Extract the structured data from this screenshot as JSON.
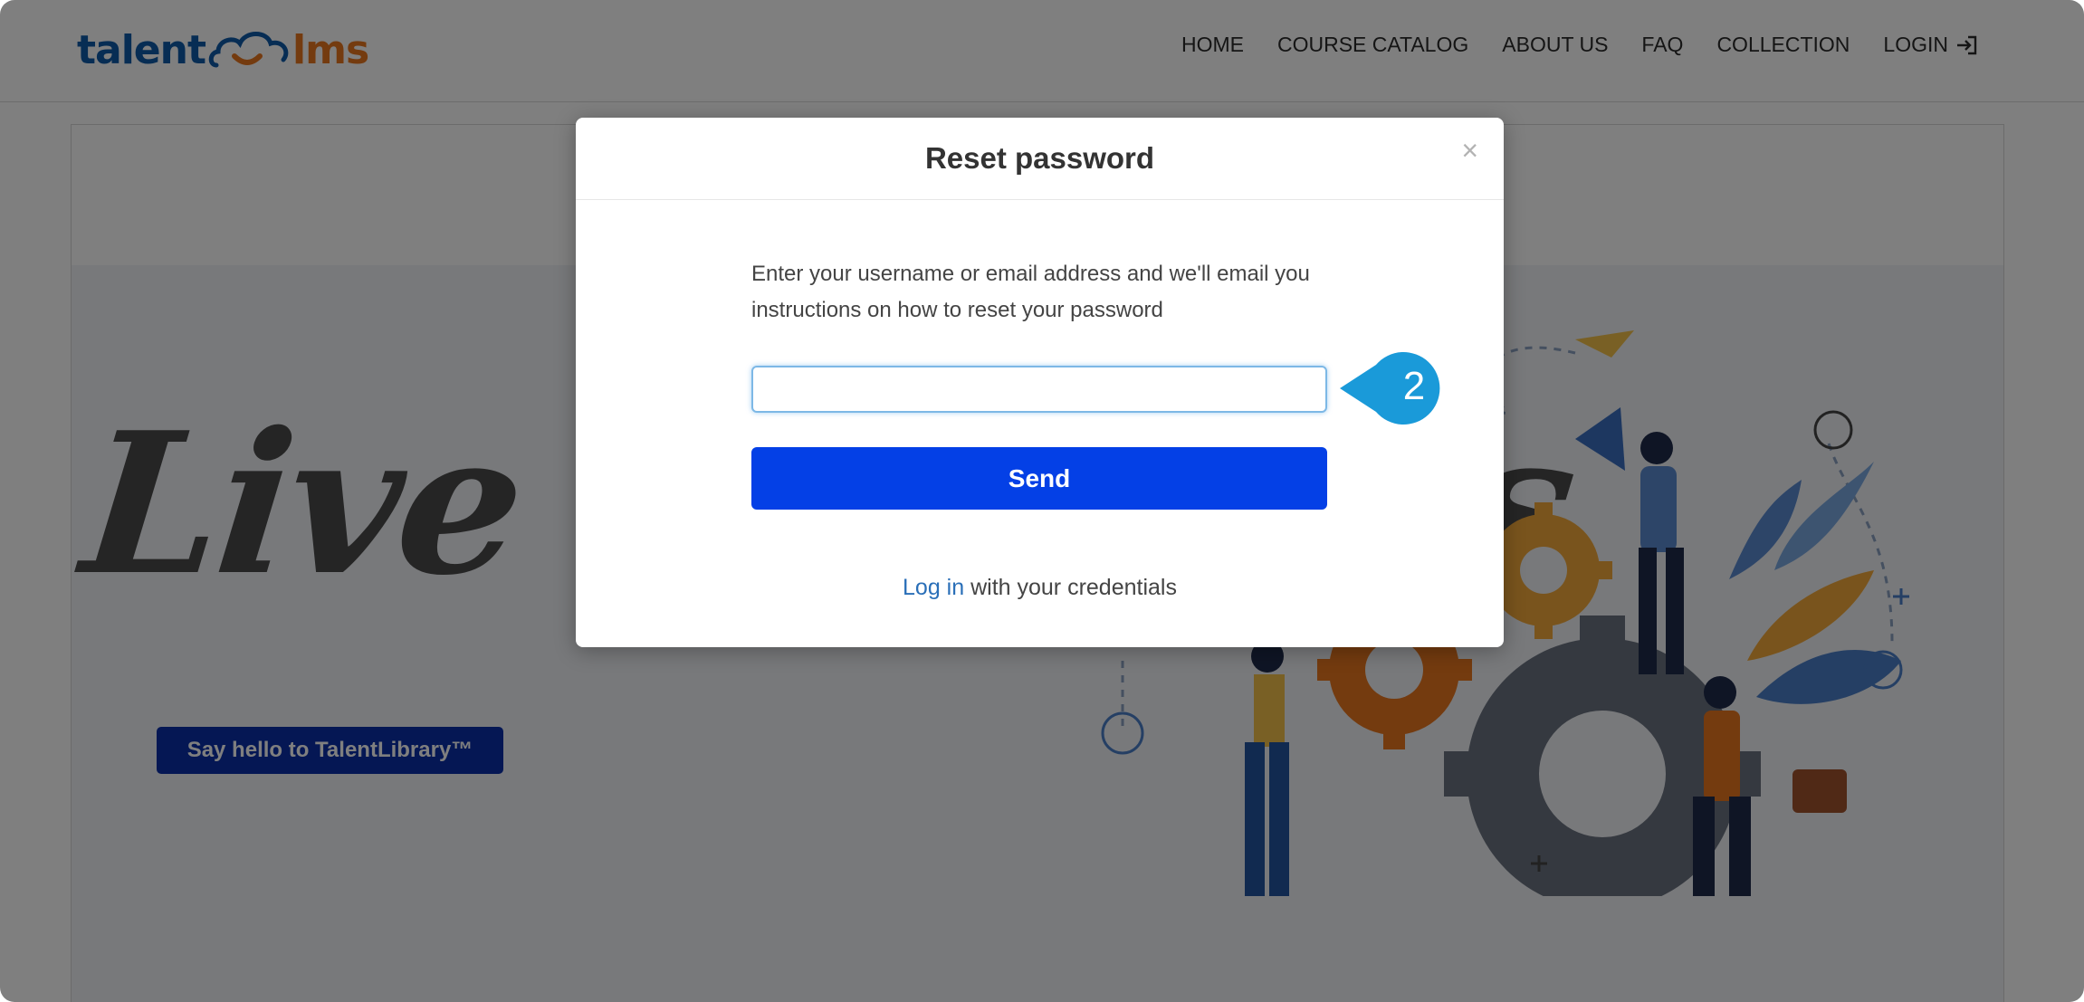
{
  "header": {
    "logo": {
      "part1": "talent",
      "part2": "lms"
    },
    "nav": {
      "items": [
        "HOME",
        "COURSE CATALOG",
        "ABOUT US",
        "FAQ",
        "COLLECTION",
        "LOGIN"
      ],
      "login_icon": "sign-in-icon"
    }
  },
  "banner": {
    "title": "Live Webinars",
    "cta_label": "Say hello to TalentLibrary™"
  },
  "modal": {
    "title": "Reset password",
    "close_symbol": "×",
    "instructions": "Enter your username or email address and we'll email you instructions on how to reset your password",
    "input_value": "",
    "send_label": "Send",
    "login_link": "Log in",
    "login_suffix": " with your credentials"
  },
  "callout": {
    "step": "2",
    "color": "#1a9ad9"
  },
  "colors": {
    "brand_blue": "#0f5aa8",
    "brand_orange": "#e8761f",
    "send_button": "#0440e6",
    "cta_button": "#0b2fa8",
    "link": "#2a6fb8"
  }
}
